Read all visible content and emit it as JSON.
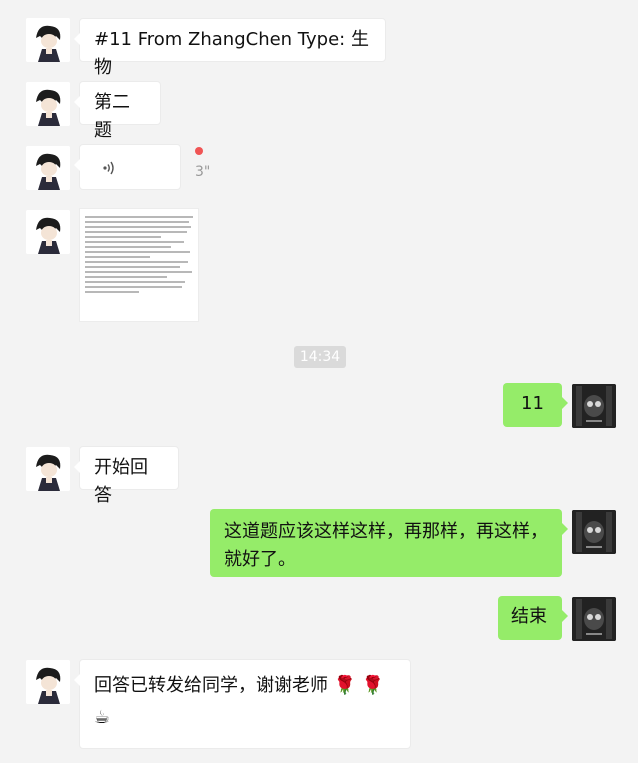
{
  "messages": {
    "m1": "#11 From ZhangChen Type: 生物",
    "m2": "第二题",
    "voice_duration": "3\"",
    "timestamp": "14:34",
    "m5": "11",
    "m6": "开始回答",
    "m7": "这道题应该这样这样，再那样，再这样，就好了。",
    "m8": "结束",
    "m9": "回答已转发给同学，谢谢老师",
    "m9_emoji": "🌹 🌹 ☕"
  },
  "colors": {
    "background": "#f3f3f3",
    "sent_bubble": "#95ec69",
    "received_bubble": "#ffffff",
    "unread_dot": "#f05454"
  },
  "icons": {
    "left_avatar": "cartoon-boy-avatar",
    "right_avatar": "dark-photo-avatar",
    "voice": "voice-waves-icon"
  }
}
